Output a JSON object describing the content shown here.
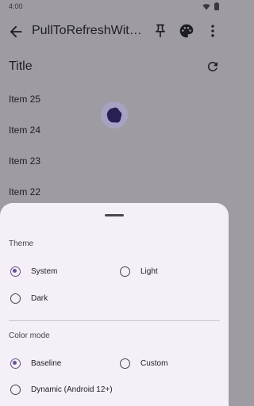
{
  "status_bar": {
    "time": "4:00"
  },
  "app_bar": {
    "title": "PullToRefreshWith..."
  },
  "content": {
    "title": "Title",
    "items": [
      "Item 25",
      "Item 24",
      "Item 23",
      "Item 22"
    ]
  },
  "sheet": {
    "theme_label": "Theme",
    "theme_options": [
      {
        "label": "System",
        "selected": true
      },
      {
        "label": "Light",
        "selected": false
      },
      {
        "label": "Dark",
        "selected": false
      }
    ],
    "color_mode_label": "Color mode",
    "color_mode_options": [
      {
        "label": "Baseline",
        "selected": true
      },
      {
        "label": "Custom",
        "selected": false
      },
      {
        "label": "Dynamic (Android 12+)",
        "selected": false
      }
    ]
  },
  "colors": {
    "scrim": "#9e9ca2",
    "sheet_background": "#f5eff7",
    "accent": "#65558f",
    "indicator_shape": "#2a1f55"
  },
  "icons": {
    "back": "arrow-back-icon",
    "pin": "pin-icon",
    "palette": "palette-icon",
    "more": "more-vert-icon",
    "refresh": "refresh-icon",
    "indicator": "loading-shape-icon"
  }
}
